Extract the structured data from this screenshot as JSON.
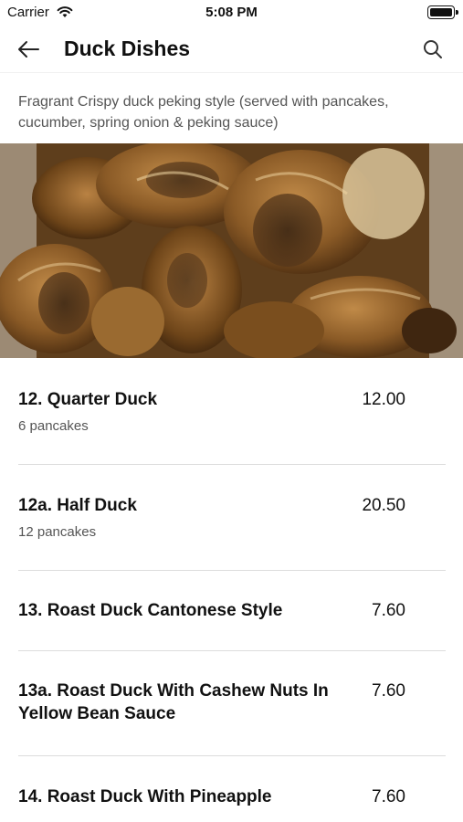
{
  "status_bar": {
    "carrier": "Carrier",
    "time": "5:08 PM"
  },
  "nav": {
    "title": "Duck Dishes",
    "back_icon": "arrow-left-icon",
    "search_icon": "search-icon"
  },
  "category": {
    "description": "Fragrant Crispy duck peking style (served with pancakes, cucumber, spring onion & peking sauce)",
    "image_alt": "Dish photo"
  },
  "items": [
    {
      "name": "12. Quarter Duck",
      "price": "12.00",
      "description": "6 pancakes"
    },
    {
      "name": "12a. Half Duck",
      "price": "20.50",
      "description": "12 pancakes"
    },
    {
      "name": "13. Roast Duck Cantonese Style",
      "price": "7.60",
      "description": ""
    },
    {
      "name": "13a. Roast Duck With Cashew Nuts In Yellow Bean Sauce",
      "price": "7.60",
      "description": ""
    },
    {
      "name": "14. Roast Duck With Pineapple",
      "price": "7.60",
      "description": ""
    }
  ],
  "colors": {
    "text": "#111111",
    "secondary": "#555555",
    "divider": "#dcdcdc"
  }
}
